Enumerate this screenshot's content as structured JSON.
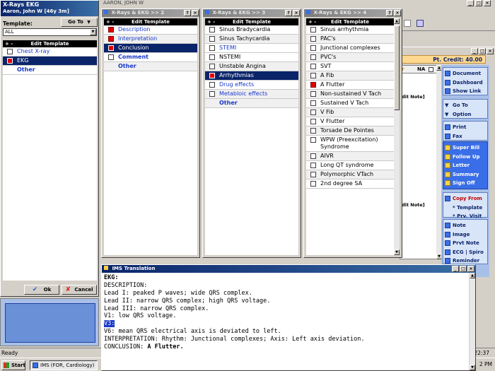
{
  "main_window": {
    "title": "AARON, JOHN W",
    "pt_credit": "Pt. Credit: 40.00",
    "na_label": "NA",
    "edit_note_1": "dit Note]",
    "edit_note_2": "dit Note]",
    "status_text": "Ready",
    "clock_1": "22:37",
    "clock_2": "2 PM"
  },
  "sidebar": {
    "group1": [
      {
        "label": "Document",
        "icon": "document-icon"
      },
      {
        "label": "Dashboard",
        "icon": "dashboard-icon"
      },
      {
        "label": "Show Link",
        "icon": "link-icon"
      }
    ],
    "group2": [
      {
        "label": "Go To",
        "icon": "arrow-down-icon"
      },
      {
        "label": "Option",
        "icon": "arrow-down-icon"
      }
    ],
    "group3": [
      {
        "label": "Print",
        "icon": "print-icon"
      },
      {
        "label": "Fax",
        "icon": "fax-icon"
      }
    ],
    "group4": [
      {
        "label": "Super Bill",
        "icon": "superbill-icon"
      },
      {
        "label": "Follow Up",
        "icon": "followup-icon"
      },
      {
        "label": "Letter",
        "icon": "letter-icon"
      },
      {
        "label": "Summary",
        "icon": "summary-icon"
      },
      {
        "label": "Sign Off",
        "icon": "signoff-icon"
      }
    ],
    "group5": [
      {
        "label": "Copy From",
        "icon": "copy-icon"
      },
      {
        "label": "* Template",
        "icon": ""
      },
      {
        "label": "* Prv. Visit",
        "icon": ""
      }
    ],
    "group6": [
      {
        "label": "Note",
        "icon": "note-icon"
      },
      {
        "label": "Image",
        "icon": "image-icon"
      },
      {
        "label": "Prvt Note",
        "icon": "private-note-icon"
      },
      {
        "label": "ECG | Spiro",
        "icon": "ecg-icon"
      },
      {
        "label": "Reminder",
        "icon": "reminder-icon"
      }
    ]
  },
  "xrays_window": {
    "title": "X-Rays  EKG",
    "patient": "Aaron, John W  [46y 3m]",
    "template_label": "Template:",
    "goto_label": "Go To",
    "template_value": "ALL",
    "list_header": "Edit Template",
    "items": [
      {
        "label": "Chest X-ray",
        "style": "blue",
        "check": "empty"
      },
      {
        "label": "EKG",
        "style": "sel",
        "check": "red"
      },
      {
        "label": "Other",
        "style": "boldblue",
        "check": "none"
      }
    ],
    "ok_label": "Ok",
    "cancel_label": "Cancel"
  },
  "panel2": {
    "title": "X-Rays & EKG >> 2",
    "header": "Edit Template",
    "items": [
      {
        "label": "Description",
        "style": "blue",
        "check": "red"
      },
      {
        "label": "Interpretation",
        "style": "blue alt",
        "check": "red"
      },
      {
        "label": "Conclusion",
        "style": "sel",
        "check": "red"
      },
      {
        "label": "Comment",
        "style": "boldblue",
        "check": "empty"
      },
      {
        "label": "Other",
        "style": "boldblue alt",
        "check": "none"
      }
    ]
  },
  "panel3": {
    "title": "X-Rays & EKG >> 3",
    "header": "Edit Template",
    "items": [
      {
        "label": "Sinus Bradycardia",
        "style": "",
        "check": "empty"
      },
      {
        "label": "Sinus Tachycardia",
        "style": "alt",
        "check": "empty"
      },
      {
        "label": "STEMI",
        "style": "blue",
        "check": "empty"
      },
      {
        "label": "NSTEMI",
        "style": "",
        "check": "empty"
      },
      {
        "label": "Unstable Angina",
        "style": "alt",
        "check": "empty"
      },
      {
        "label": "Arrhythmias",
        "style": "sel",
        "check": "red"
      },
      {
        "label": "Drug effects",
        "style": "blue",
        "check": "empty"
      },
      {
        "label": "Metabloic effects",
        "style": "blue alt",
        "check": "empty"
      },
      {
        "label": "Other",
        "style": "boldblue alt",
        "check": "none"
      }
    ]
  },
  "panel4": {
    "title": "X-Rays & EKG >> 4",
    "header": "Edit Template",
    "items": [
      {
        "label": "Sinus arrhythmia",
        "style": "",
        "check": "empty"
      },
      {
        "label": "PAC's",
        "style": "alt",
        "check": "empty"
      },
      {
        "label": "Junctional complexes",
        "style": "",
        "check": "empty"
      },
      {
        "label": "PVC's",
        "style": "alt",
        "check": "empty"
      },
      {
        "label": "SVT",
        "style": "",
        "check": "empty"
      },
      {
        "label": "A Fib",
        "style": "alt",
        "check": "empty"
      },
      {
        "label": "A Flutter",
        "style": "",
        "check": "red"
      },
      {
        "label": "Non-sustained V Tach",
        "style": "alt",
        "check": "empty"
      },
      {
        "label": "Sustained V Tach",
        "style": "",
        "check": "empty"
      },
      {
        "label": "V Fib",
        "style": "alt",
        "check": "empty"
      },
      {
        "label": "V Flutter",
        "style": "",
        "check": "empty"
      },
      {
        "label": "Torsade De Pointes",
        "style": "alt",
        "check": "empty"
      },
      {
        "label": "WPW (Preexcitation) Syndrome",
        "style": "",
        "check": "empty"
      },
      {
        "label": "AIVR",
        "style": "alt",
        "check": "empty"
      },
      {
        "label": "Long QT syndrome",
        "style": "",
        "check": "empty"
      },
      {
        "label": "Polymorphic VTach",
        "style": "alt",
        "check": "empty"
      },
      {
        "label": "2nd degree SA",
        "style": "",
        "check": "empty"
      }
    ]
  },
  "translation": {
    "title": "IMS Translation",
    "lines": [
      "EKG:",
      "DESCRIPTION:",
      "Lead I: peaked P waves; wide QRS complex.",
      "Lead II: narrow QRS complex; high QRS voltage.",
      "Lead III: narrow QRS complex.",
      "V1: low QRS voltage.",
      "V3:",
      "V6: mean QRS electrical axis is deviated to left.",
      "INTERPRETATION: Rhythm: Junctional complexes; Axis: Left axis deviation.",
      "CONCLUSION:  A Flutter."
    ]
  },
  "taskbar": {
    "start_label": "Start",
    "task_label": "IMS (FOR, Cardiology)"
  }
}
